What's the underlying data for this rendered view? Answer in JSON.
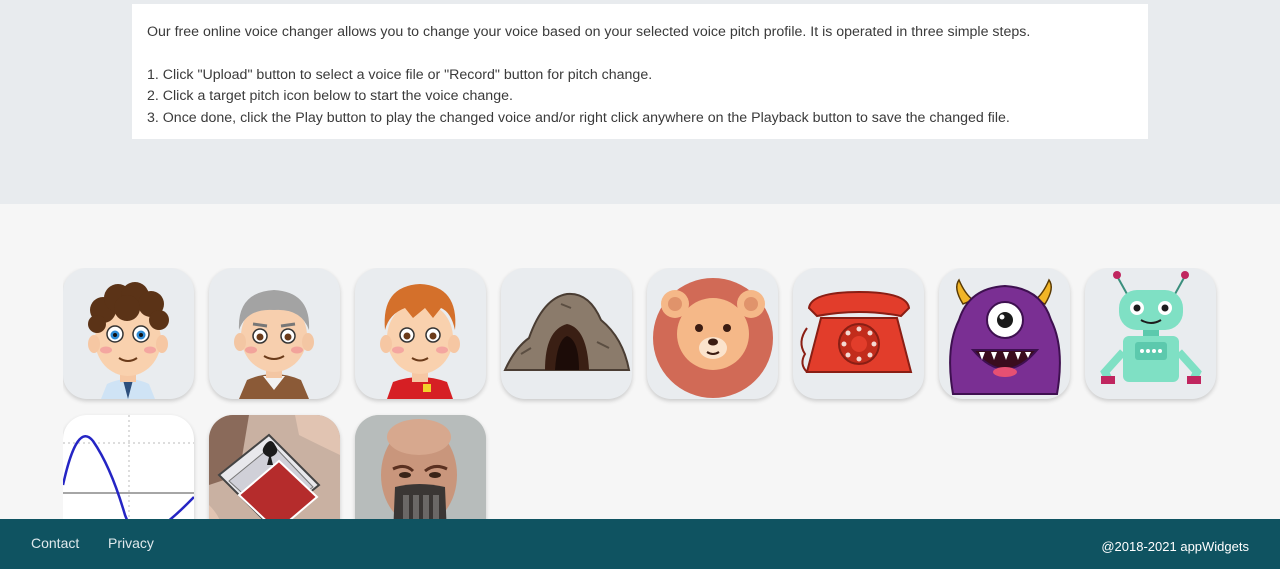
{
  "instructions": {
    "intro": "Our free online voice changer allows you to change your voice based on your selected voice pitch profile. It is operated in three simple steps.",
    "steps": [
      "1. Click \"Upload\" button to select a voice file or \"Record\" button for pitch change.",
      "2. Click a target pitch icon below to start the voice change.",
      "3. Once done, click the Play button to play the changed voice and/or right click anywhere on the Playback button to save the changed file."
    ]
  },
  "pitch_icons": [
    {
      "icon": "man-icon"
    },
    {
      "icon": "old-man-icon"
    },
    {
      "icon": "boy-icon"
    },
    {
      "icon": "cave-icon"
    },
    {
      "icon": "bear-icon"
    },
    {
      "icon": "telephone-icon"
    },
    {
      "icon": "monster-icon"
    },
    {
      "icon": "robot-icon"
    },
    {
      "icon": "sine-wave-icon"
    },
    {
      "icon": "playing-cards-icon"
    },
    {
      "icon": "masked-villain-icon"
    }
  ],
  "colors": {
    "top_band": "#e8ebee",
    "page_background": "#f6f6f6",
    "tile_background": "#e9ecef",
    "footer_background": "#0f5361"
  },
  "footer": {
    "contact": "Contact",
    "privacy": "Privacy",
    "copyright": "@2018-2021 appWidgets"
  }
}
